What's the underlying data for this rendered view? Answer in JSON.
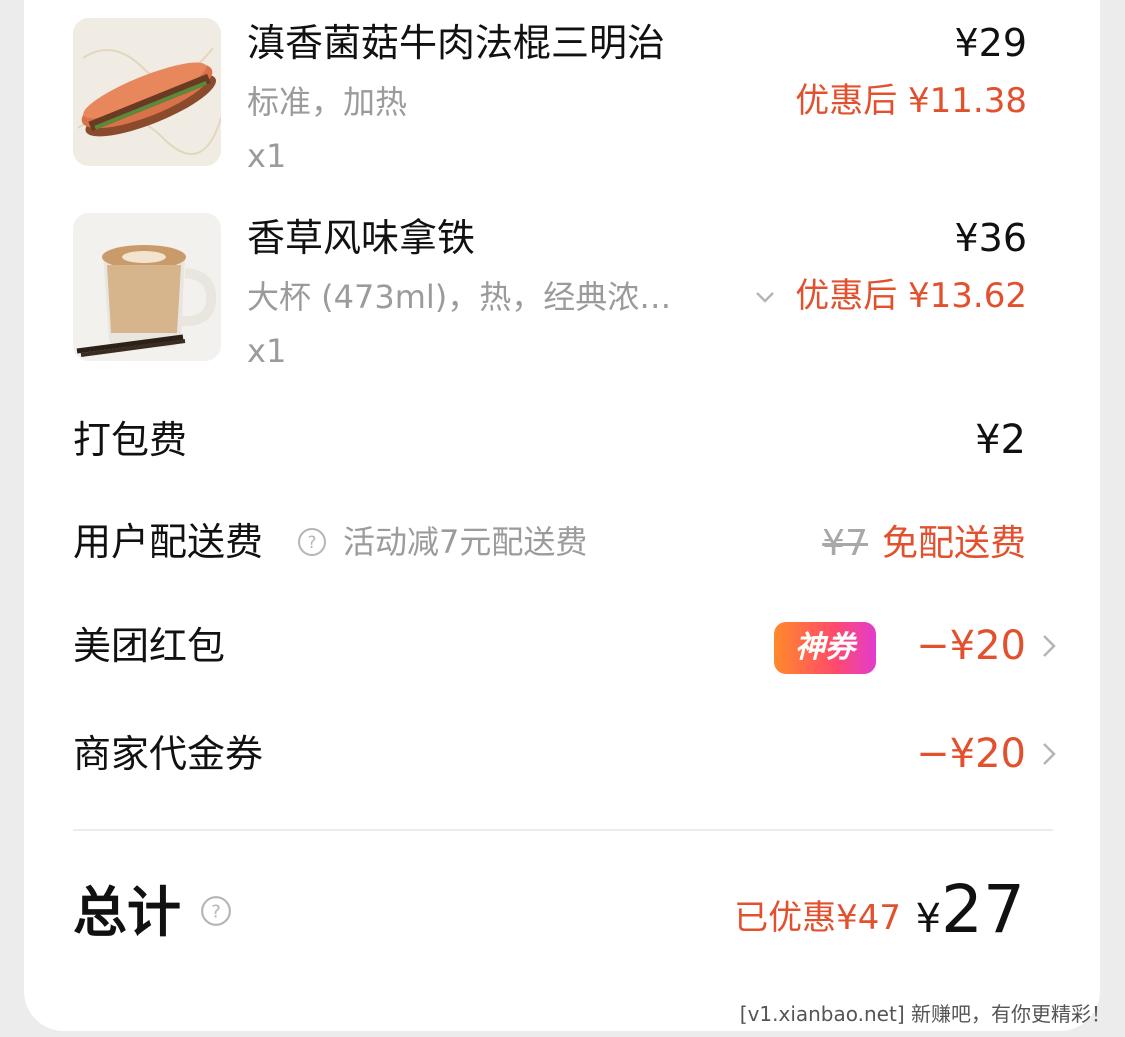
{
  "items": [
    {
      "name": "滇香菌菇牛肉法棍三明治",
      "spec": "标准，加热",
      "qty": "x1",
      "price": "¥29",
      "discounted": "优惠后 ¥11.38",
      "image": "sandwich-image"
    },
    {
      "name": "香草风味拿铁",
      "spec": "大杯 (473ml)，热，经典浓…",
      "qty": "x1",
      "price": "¥36",
      "discounted": "优惠后 ¥13.62",
      "image": "latte-image"
    }
  ],
  "fees": {
    "packing_label": "打包费",
    "packing_value": "¥2",
    "delivery_label": "用户配送费",
    "delivery_note": "活动减7元配送费",
    "delivery_original": "¥7",
    "delivery_value": "免配送费"
  },
  "discounts": {
    "meituan_label": "美团红包",
    "meituan_badge": "神券",
    "meituan_value": "−¥20",
    "merchant_label": "商家代金券",
    "merchant_value": "−¥20"
  },
  "total": {
    "label": "总计",
    "saved": "已优惠¥47",
    "currency": "¥",
    "amount": "27"
  },
  "watermark": "[v1.xianbao.net] 新赚吧，有你更精彩！",
  "colors": {
    "accent_red": "#e2502e",
    "text_primary": "#111111",
    "text_secondary": "#9b9b9b",
    "badge_gradient_start": "#ff8a2a",
    "badge_gradient_end": "#e23ccf"
  }
}
